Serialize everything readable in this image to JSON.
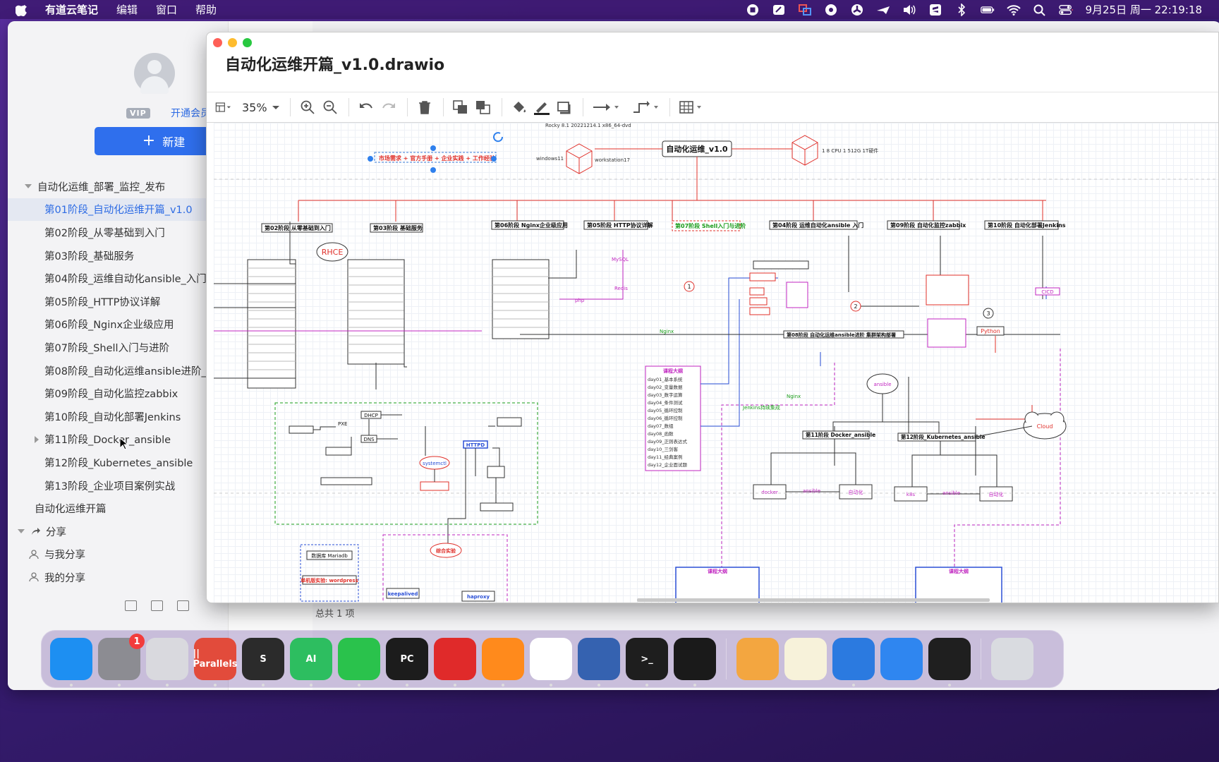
{
  "menubar": {
    "app_name": "有道云笔记",
    "menus": [
      "编辑",
      "窗口",
      "帮助"
    ],
    "clock": "9月25日 周一  22:19:18",
    "colors": {
      "bar": "#3c196e"
    }
  },
  "sidebar": {
    "vip_badge": "VIP",
    "member_link": "开通会员",
    "new_button": "新建",
    "tree": [
      {
        "label": "自动化运维_部署_监控_发布",
        "level": 0,
        "expanded": true
      },
      {
        "label": "第01阶段_自动化运维开篇_v1.0",
        "level": 1,
        "selected": true
      },
      {
        "label": "第02阶段_从零基础到入门",
        "level": 1
      },
      {
        "label": "第03阶段_基础服务",
        "level": 1
      },
      {
        "label": "第04阶段_运维自动化ansible_入门",
        "level": 1
      },
      {
        "label": "第05阶段_HTTP协议详解",
        "level": 1
      },
      {
        "label": "第06阶段_Nginx企业级应用",
        "level": 1
      },
      {
        "label": "第07阶段_Shell入门与进阶",
        "level": 1
      },
      {
        "label": "第08阶段_自动化运维ansible进阶_集",
        "level": 1
      },
      {
        "label": "第09阶段_自动化监控zabbix",
        "level": 1
      },
      {
        "label": "第10阶段_自动化部署Jenkins",
        "level": 1
      },
      {
        "label": "第11阶段_Docker_ansible",
        "level": 1,
        "collapsed": true
      },
      {
        "label": "第12阶段_Kubernetes_ansible",
        "level": 1
      },
      {
        "label": "第13阶段_企业项目案例实战",
        "level": 1
      },
      {
        "label": "自动化运维开篇",
        "level": 0
      }
    ],
    "share_section": "分享",
    "share_items": [
      "与我分享",
      "我的分享"
    ],
    "status": "总共 1 项"
  },
  "drawio": {
    "title": "自动化运维开篇_v1.0.drawio",
    "zoom": "35%",
    "diagram": {
      "root": "自动化运维_v1.0",
      "top_left_note": "市场需求 + 官方手册 + 企业实践 + 工作经验",
      "hw_left": "Rocky 8.1 20221214.1 x86_64-dvd",
      "win_label": "windows11",
      "ws_label": "workstation17",
      "hw_right": "1 8 CPU  1 512G  1T硬件",
      "stages": [
        "第02阶段 从零基础到入门",
        "第03阶段 基础服务",
        "第06阶段 Nginx企业级应用",
        "第05阶段 HTTP协议详解",
        "第07阶段 Shell入门与进阶",
        "第04阶段 运维自动化ansible 入门",
        "第09阶段 自动化监控zabbix",
        "第10阶段 自动化部署Jenkins"
      ],
      "rhce": "RHCE",
      "course_outline": "课程大纲",
      "stage08": "第08阶段 自动化运维ansible进阶 集群架构部署",
      "stage11": "第11阶段 Docker_ansible",
      "stage12": "第12阶段_Kubernetes_ansible",
      "ansible": "ansible",
      "cloud": "Cloud",
      "cicd": "CICD",
      "python": "Python",
      "docker": "docker",
      "k8s": "k8s",
      "auto": "自动化",
      "auto2": "自动化",
      "systemctl": "systemctl",
      "httpd": "HTTPD",
      "dhcp": "DHCP",
      "dns": "DNS",
      "pxe": "PXE",
      "day_list": [
        "day01_基本系统",
        "day02_变量数据",
        "day03_数字运算",
        "day04_条件测试",
        "day05_循环控制",
        "day06_循环控制",
        "day07_数组",
        "day08_函数",
        "day09_正则表达式",
        "day10_三剑客",
        "day11_经典案例",
        "day12_企业面试题"
      ],
      "keepalived": "keepalived",
      "haproxy": "haproxy",
      "db_label": "数据库 Mariadb",
      "wp_label": "单机版实验: wordpress",
      "final": "综合实验",
      "ansible_lbl": "ansible",
      "nginx_lbl": "Nginx",
      "jenkins_lbl": "Jenkins持续集成",
      "mysql_lbl": "MySQL",
      "redis_lbl": "Redis",
      "php_lbl": "php"
    }
  },
  "dock": {
    "apps": [
      {
        "name": "finder",
        "label": "",
        "bg": "#1d8ff2"
      },
      {
        "name": "system-settings",
        "label": "",
        "bg": "#8c8c92",
        "badge": "1"
      },
      {
        "name": "launchpad",
        "label": "",
        "bg": "#d9d9de"
      },
      {
        "name": "parallels",
        "label": "|| Parallels",
        "bg": "#e24b3b"
      },
      {
        "name": "sublime",
        "label": "S",
        "bg": "#2b2b2b"
      },
      {
        "name": "evernote",
        "label": "AI",
        "bg": "#2dbe60"
      },
      {
        "name": "wechat",
        "label": "",
        "bg": "#2ac24c"
      },
      {
        "name": "pycharm",
        "label": "PC",
        "bg": "#1c1c1c"
      },
      {
        "name": "xmind",
        "label": "",
        "bg": "#e02a2a"
      },
      {
        "name": "firefox",
        "label": "",
        "bg": "#ff8a1c"
      },
      {
        "name": "chrome",
        "label": "",
        "bg": "#ffffff"
      },
      {
        "name": "vmware",
        "label": "",
        "bg": "#3562b0"
      },
      {
        "name": "terminal",
        "label": ">_",
        "bg": "#1e1e1e"
      },
      {
        "name": "activity-monitor",
        "label": "",
        "bg": "#1a1a1a"
      },
      {
        "name": "nutstore",
        "label": "",
        "bg": "#f3a640"
      },
      {
        "name": "notes",
        "label": "",
        "bg": "#f7f2da"
      },
      {
        "name": "keynote",
        "label": "",
        "bg": "#2b7ae0"
      },
      {
        "name": "pages",
        "label": "",
        "bg": "#2f86f0"
      },
      {
        "name": "quicktime",
        "label": "",
        "bg": "#1f1f1f"
      },
      {
        "name": "trash",
        "label": "",
        "bg": "#d9dbe0"
      }
    ]
  }
}
